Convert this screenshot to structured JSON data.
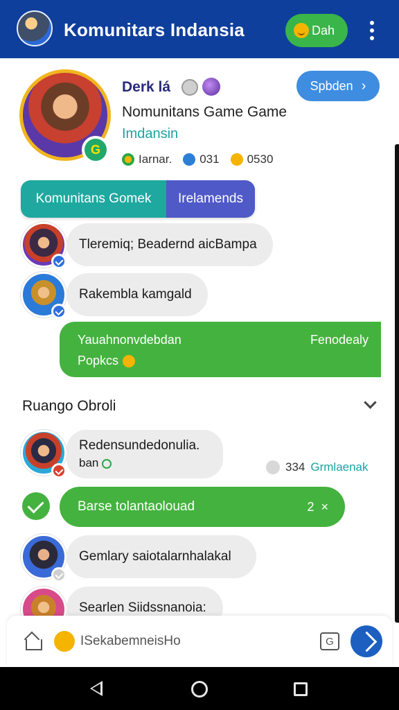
{
  "header": {
    "title": "Komunitars Indansia",
    "status_label": "Dah"
  },
  "profile": {
    "name": "Derk lá",
    "subtitle": "Nomunitans Game Game",
    "location": "Imdansin",
    "badge_letter": "G",
    "action_label": "Spbden",
    "stats": [
      {
        "icon": "leaf-icon",
        "value": "Iarnar."
      },
      {
        "icon": "star-icon",
        "value": "031"
      },
      {
        "icon": "emoji-icon",
        "value": "0530"
      }
    ]
  },
  "tabs": [
    {
      "label": "Komunitans Gomek",
      "active": false
    },
    {
      "label": "Irelamends",
      "active": true
    }
  ],
  "messages_top": [
    {
      "text": "Tleremiq; Beadernd aicBampa"
    },
    {
      "text": "Rakembla kamgald"
    }
  ],
  "highlight_message": {
    "line1_left": "Yauahnonvdebdan",
    "line1_right": "Fenodealy",
    "line2": "Popkcs"
  },
  "section": {
    "title": "Ruango Obroli"
  },
  "room_messages": [
    {
      "line1": "Redensundedonulia.",
      "line2": "ban"
    },
    {
      "text": "Gemlary saiotalarnhalakal"
    },
    {
      "text": "Searlen Siidssnanoia:"
    }
  ],
  "room_meta": {
    "count": "334",
    "label": "Grmlaenak"
  },
  "selected_item": {
    "text": "Barse tolantaolouad",
    "count": "2",
    "close": "×"
  },
  "composer": {
    "placeholder": "ISekabemneisHo",
    "attach_glyph": "G"
  },
  "colors": {
    "topbar": "#0f3f9c",
    "green": "#44b23e",
    "teal": "#1fa8a0",
    "indigo": "#4f59c8",
    "blue_button": "#3f8de0",
    "send": "#1c5fc0"
  }
}
